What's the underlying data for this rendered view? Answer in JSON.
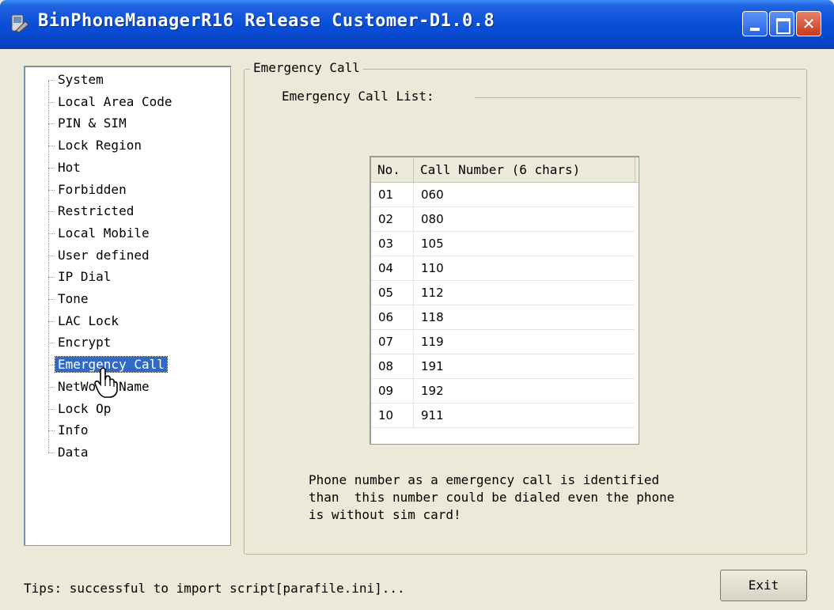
{
  "window": {
    "title": "BinPhoneManagerR16 Release Customer-D1.0.8",
    "icon": "app-icon",
    "close_glyph": "✕"
  },
  "tree": {
    "items": [
      "System",
      "Local Area Code",
      "PIN & SIM",
      "Lock Region",
      "Hot",
      "Forbidden",
      "Restricted",
      "Local Mobile",
      "User defined",
      "IP Dial",
      "Tone",
      "LAC Lock",
      "Encrypt",
      "Emergency Call",
      "NetWork Name",
      "Lock Op",
      "Info",
      "Data"
    ],
    "selected": "Emergency Call"
  },
  "panel": {
    "group_title": "Emergency Call",
    "list_caption": "Emergency Call List:",
    "table": {
      "headers": [
        "No.",
        "Call Number (6 chars)"
      ],
      "rows": [
        [
          "01",
          "060"
        ],
        [
          "02",
          "080"
        ],
        [
          "03",
          "105"
        ],
        [
          "04",
          "110"
        ],
        [
          "05",
          "112"
        ],
        [
          "06",
          "118"
        ],
        [
          "07",
          "119"
        ],
        [
          "08",
          "191"
        ],
        [
          "09",
          "192"
        ],
        [
          "10",
          "911"
        ]
      ]
    },
    "note": "Phone number as a emergency call is identified\nthan  this number could be dialed even the phone\nis without sim card!"
  },
  "status": {
    "tips": "Tips: successful to import script[parafile.ini]..."
  },
  "buttons": {
    "exit_label": "Exit"
  },
  "colors": {
    "titlebar": "#0a4fd8",
    "window_bg": "#ece9d8",
    "selection": "#316ac5"
  }
}
